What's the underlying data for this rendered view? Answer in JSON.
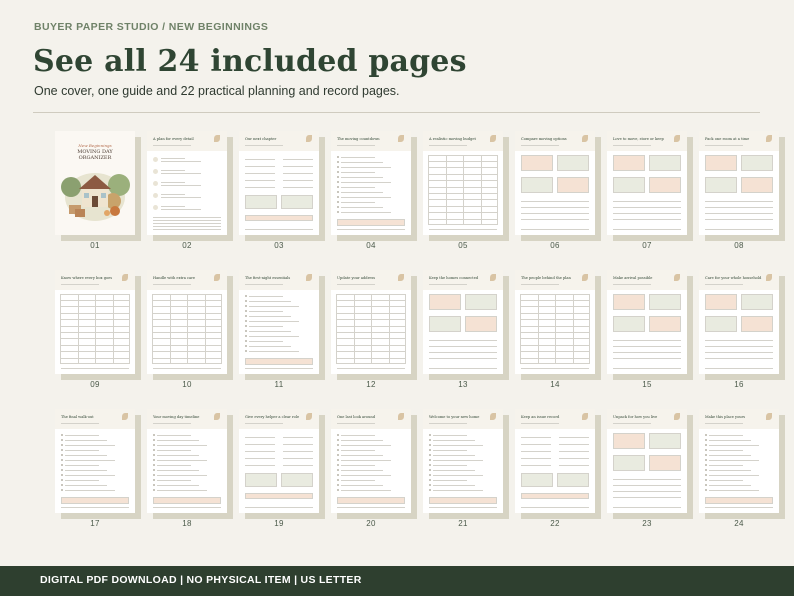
{
  "header": {
    "brand": "BUYER PAPER STUDIO  /  NEW BEGINNINGS",
    "title": "See all 24 included pages",
    "subtitle": "One cover, one guide and 22 practical planning and record pages."
  },
  "colors": {
    "accent": "#2e3f2f",
    "page_header": "#f6f3ec",
    "peach": "#f5e2d4",
    "sage": "#e9ebe0",
    "shadow": "#d7d4c4"
  },
  "cover": {
    "script": "New Beginnings",
    "title_line1": "MOVING DAY",
    "title_line2": "ORGANIZER"
  },
  "pages": [
    {
      "number": "01",
      "title": "",
      "layout": "cover"
    },
    {
      "number": "02",
      "title": "A plan for every detail",
      "layout": "guide"
    },
    {
      "number": "03",
      "title": "Our next chapter",
      "layout": "form"
    },
    {
      "number": "04",
      "title": "The moving countdown",
      "layout": "checklist"
    },
    {
      "number": "05",
      "title": "A realistic moving budget",
      "layout": "table"
    },
    {
      "number": "06",
      "title": "Compare moving options",
      "layout": "boxes"
    },
    {
      "number": "07",
      "title": "Love to move, store or keep",
      "layout": "boxes"
    },
    {
      "number": "08",
      "title": "Pack one room at a time",
      "layout": "boxes"
    },
    {
      "number": "09",
      "title": "Know where every box goes",
      "layout": "table"
    },
    {
      "number": "10",
      "title": "Handle with extra care",
      "layout": "table"
    },
    {
      "number": "11",
      "title": "The first-night essentials",
      "layout": "checklist"
    },
    {
      "number": "12",
      "title": "Update your address",
      "layout": "table"
    },
    {
      "number": "13",
      "title": "Keep the homes connected",
      "layout": "boxes"
    },
    {
      "number": "14",
      "title": "The people behind the plan",
      "layout": "table"
    },
    {
      "number": "15",
      "title": "Make arrival possible",
      "layout": "boxes"
    },
    {
      "number": "16",
      "title": "Care for your whole household",
      "layout": "boxes"
    },
    {
      "number": "17",
      "title": "The final walk-out",
      "layout": "checklist"
    },
    {
      "number": "18",
      "title": "Your moving day timeline",
      "layout": "checklist"
    },
    {
      "number": "19",
      "title": "Give every helper a clear role",
      "layout": "form"
    },
    {
      "number": "20",
      "title": "One last look around",
      "layout": "checklist"
    },
    {
      "number": "21",
      "title": "Welcome to your new home",
      "layout": "checklist"
    },
    {
      "number": "22",
      "title": "Keep an issue record",
      "layout": "form"
    },
    {
      "number": "23",
      "title": "Unpack for how you live",
      "layout": "boxes"
    },
    {
      "number": "24",
      "title": "Make this place yours",
      "layout": "checklist"
    }
  ],
  "footer": {
    "text": "DIGITAL PDF DOWNLOAD  |  NO PHYSICAL ITEM  |  US LETTER"
  }
}
